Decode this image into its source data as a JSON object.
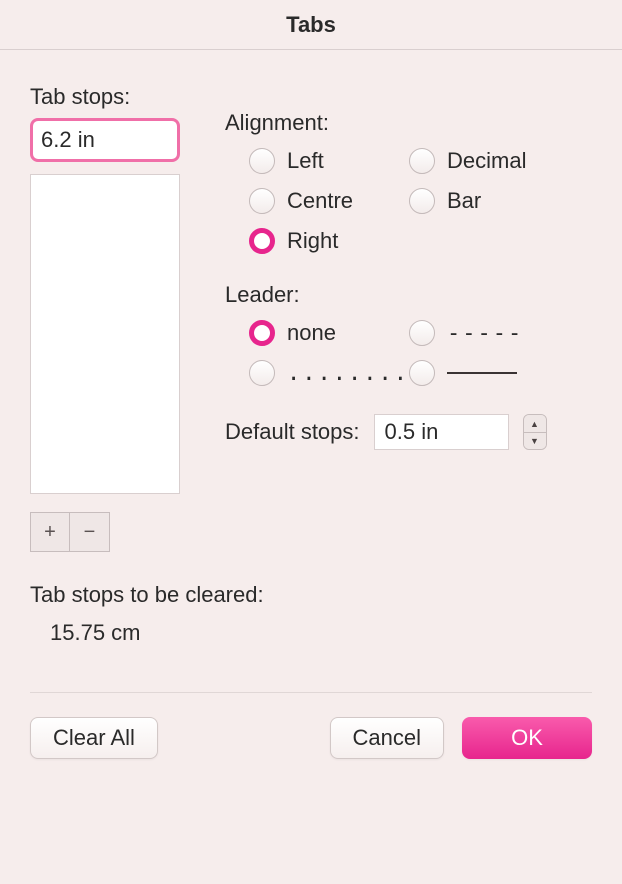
{
  "dialog": {
    "title": "Tabs"
  },
  "tab_stops_label": "Tab stops:",
  "tab_input_value": "6.2 in",
  "alignment": {
    "label": "Alignment:",
    "options": {
      "left": "Left",
      "centre": "Centre",
      "right": "Right",
      "decimal": "Decimal",
      "bar": "Bar"
    },
    "selected": "right"
  },
  "leader": {
    "label": "Leader:",
    "options": {
      "none": "none",
      "dots": "..........",
      "dashes": "-----",
      "underline": "_____"
    },
    "selected": "none"
  },
  "default_stops": {
    "label": "Default stops:",
    "value": "0.5 in"
  },
  "cleared": {
    "label": "Tab stops to be cleared:",
    "value": "15.75 cm"
  },
  "buttons": {
    "clear_all": "Clear All",
    "cancel": "Cancel",
    "ok": "OK",
    "plus": "+",
    "minus": "−"
  }
}
